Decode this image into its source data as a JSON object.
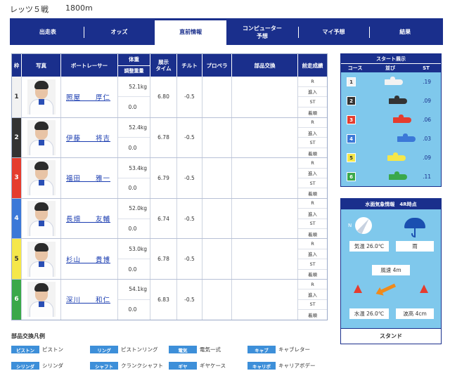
{
  "race": {
    "name": "レッツ５戦",
    "distance": "1800m"
  },
  "tabs": [
    {
      "label": "出走表",
      "active": false
    },
    {
      "label": "オッズ",
      "active": false
    },
    {
      "label": "直前情報",
      "active": true
    },
    {
      "label": "コンピューター\n予想",
      "active": false
    },
    {
      "label": "マイ予想",
      "active": false
    },
    {
      "label": "結果",
      "active": false
    }
  ],
  "table": {
    "headers": {
      "waku": "枠",
      "photo": "写真",
      "racer": "ボートレーサー",
      "weight": "体重",
      "weight_adj": "調整重量",
      "tenji": "展示\nタイム",
      "tilt": "チルト",
      "propeller": "プロペラ",
      "parts": "部品交換",
      "prev": "前走成績"
    },
    "prev_labels": [
      "R",
      "進入",
      "ST",
      "着順"
    ],
    "rows": [
      {
        "waku": "1",
        "name": "照屋　　厚仁",
        "weight": "52.1kg",
        "adjust": "0.0",
        "tenji": "6.80",
        "tilt": "-0.5",
        "color": "#f2f2f2",
        "text": "#333333"
      },
      {
        "waku": "2",
        "name": "伊藤　　将吉",
        "weight": "52.4kg",
        "adjust": "0.0",
        "tenji": "6.78",
        "tilt": "-0.5",
        "color": "#333333",
        "text": "#ffffff"
      },
      {
        "waku": "3",
        "name": "福田　　雅一",
        "weight": "53.4kg",
        "adjust": "0.0",
        "tenji": "6.79",
        "tilt": "-0.5",
        "color": "#e53c2e",
        "text": "#ffffff"
      },
      {
        "waku": "4",
        "name": "長畑　　友輔",
        "weight": "52.0kg",
        "adjust": "0.0",
        "tenji": "6.74",
        "tilt": "-0.5",
        "color": "#3b78d8",
        "text": "#ffffff"
      },
      {
        "waku": "5",
        "name": "杉山　　貴博",
        "weight": "53.0kg",
        "adjust": "0.0",
        "tenji": "6.78",
        "tilt": "-0.5",
        "color": "#f5e74a",
        "text": "#333333"
      },
      {
        "waku": "6",
        "name": "深川　　和仁",
        "weight": "54.1kg",
        "adjust": "0.0",
        "tenji": "6.83",
        "tilt": "-0.5",
        "color": "#3aa84a",
        "text": "#ffffff"
      }
    ]
  },
  "legend": {
    "title": "部品交換凡例",
    "items": [
      {
        "badge": "ピストン",
        "label": "ピストン"
      },
      {
        "badge": "リング",
        "label": "ピストンリング"
      },
      {
        "badge": "電気",
        "label": "電気一式"
      },
      {
        "badge": "キャブ",
        "label": "キャブレター"
      },
      {
        "badge": "シリンダ",
        "label": "シリンダ"
      },
      {
        "badge": "シャフト",
        "label": "クランクシャフト"
      },
      {
        "badge": "ギヤ",
        "label": "ギヤケース"
      },
      {
        "badge": "キャリボ",
        "label": "キャリアボデー"
      }
    ]
  },
  "start_display": {
    "title": "スタート展示",
    "cols": {
      "course": "コース",
      "line": "並び",
      "st": "ST"
    },
    "lanes": [
      {
        "course": "1",
        "st": ".19",
        "color": "#f2f2f2",
        "text": "#333333"
      },
      {
        "course": "2",
        "st": ".09",
        "color": "#333333",
        "text": "#ffffff"
      },
      {
        "course": "3",
        "st": ".06",
        "color": "#e53c2e",
        "text": "#ffffff"
      },
      {
        "course": "4",
        "st": ".03",
        "color": "#3b78d8",
        "text": "#ffffff"
      },
      {
        "course": "5",
        "st": ".09",
        "color": "#f5e74a",
        "text": "#333333"
      },
      {
        "course": "6",
        "st": ".11",
        "color": "#3aa84a",
        "text": "#ffffff"
      }
    ]
  },
  "weather": {
    "title": "水面気象情報　4R時点",
    "wind_dir_label": "N",
    "temp": "気温 26.0℃",
    "condition": "雨",
    "wind_speed": "風速 4m",
    "water_temp": "水温 26.0℃",
    "wave": "波高 4cm",
    "stand": "スタンド"
  }
}
